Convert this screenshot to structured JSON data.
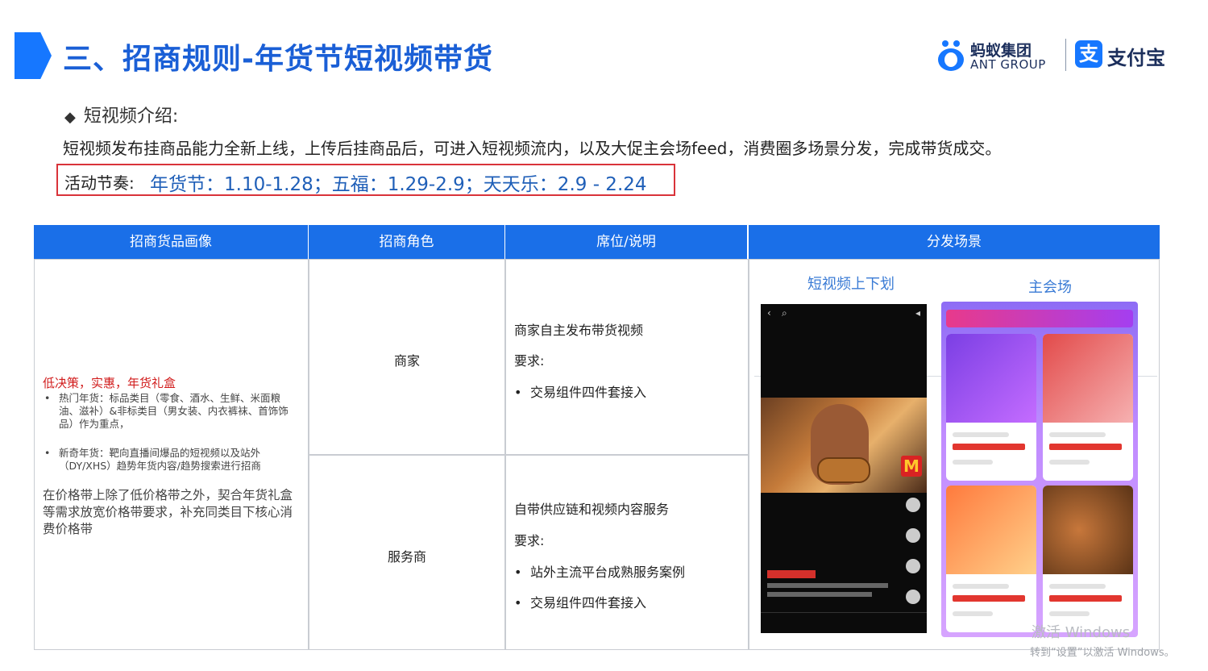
{
  "header": {
    "title": "三、招商规则-年货节短视频带货",
    "logos": {
      "ant_cn": "蚂蚁集团",
      "ant_en": "ANT GROUP",
      "alipay_mark": "支",
      "alipay_text": "支付宝"
    }
  },
  "intro": {
    "section_title": "短视频介绍:",
    "description": "短视频发布挂商品能力全新上线，上传后挂商品后，可进入短视频流内，以及大促主会场feed，消费圈多场景分发，完成带货成交。",
    "rhythm_label": "活动节奏:",
    "rhythm_value": "年货节：1.10-1.28；五福：1.29-2.9；天天乐：2.9 - 2.24"
  },
  "table": {
    "headers": [
      "招商货品画像",
      "招商角色",
      "席位/说明",
      "分发场景"
    ],
    "profile": {
      "headline": "低决策，实惠，年货礼盒",
      "bullets": [
        "热门年货：标品类目（零食、酒水、生鲜、米面粮油、滋补）&非标类目（男女装、内衣裤袜、首饰饰品）作为重点，",
        "新奇年货：靶向直播间爆品的短视频以及站外（DY/XHS）趋势年货内容/趋势搜索进行招商"
      ],
      "price_note": "在价格带上除了低价格带之外，契合年货礼盒等需求放宽价格带要求，补充同类目下核心消费价格带"
    },
    "roles": [
      {
        "name": "商家",
        "seat_title": "商家自主发布带货视频",
        "requirements_label": "要求:",
        "requirements": [
          "交易组件四件套接入"
        ]
      },
      {
        "name": "服务商",
        "seat_title": "自带供应链和视频内容服务",
        "requirements_label": "要求:",
        "requirements": [
          "站外主流平台成熟服务案例",
          "交易组件四件套接入"
        ]
      }
    ],
    "scenes": {
      "left_label": "短视频上下划",
      "right_label": "主会场"
    }
  },
  "watermark": {
    "line1": "激活 Windows",
    "line2": "转到“设置”以激活 Windows。"
  },
  "colors": {
    "accent_blue": "#1a6fe8",
    "title_blue": "#1a5fd6",
    "highlight_red": "#d9333a",
    "rhythm_blue": "#1f5fb8",
    "scene_blue": "#3a7bd5"
  }
}
